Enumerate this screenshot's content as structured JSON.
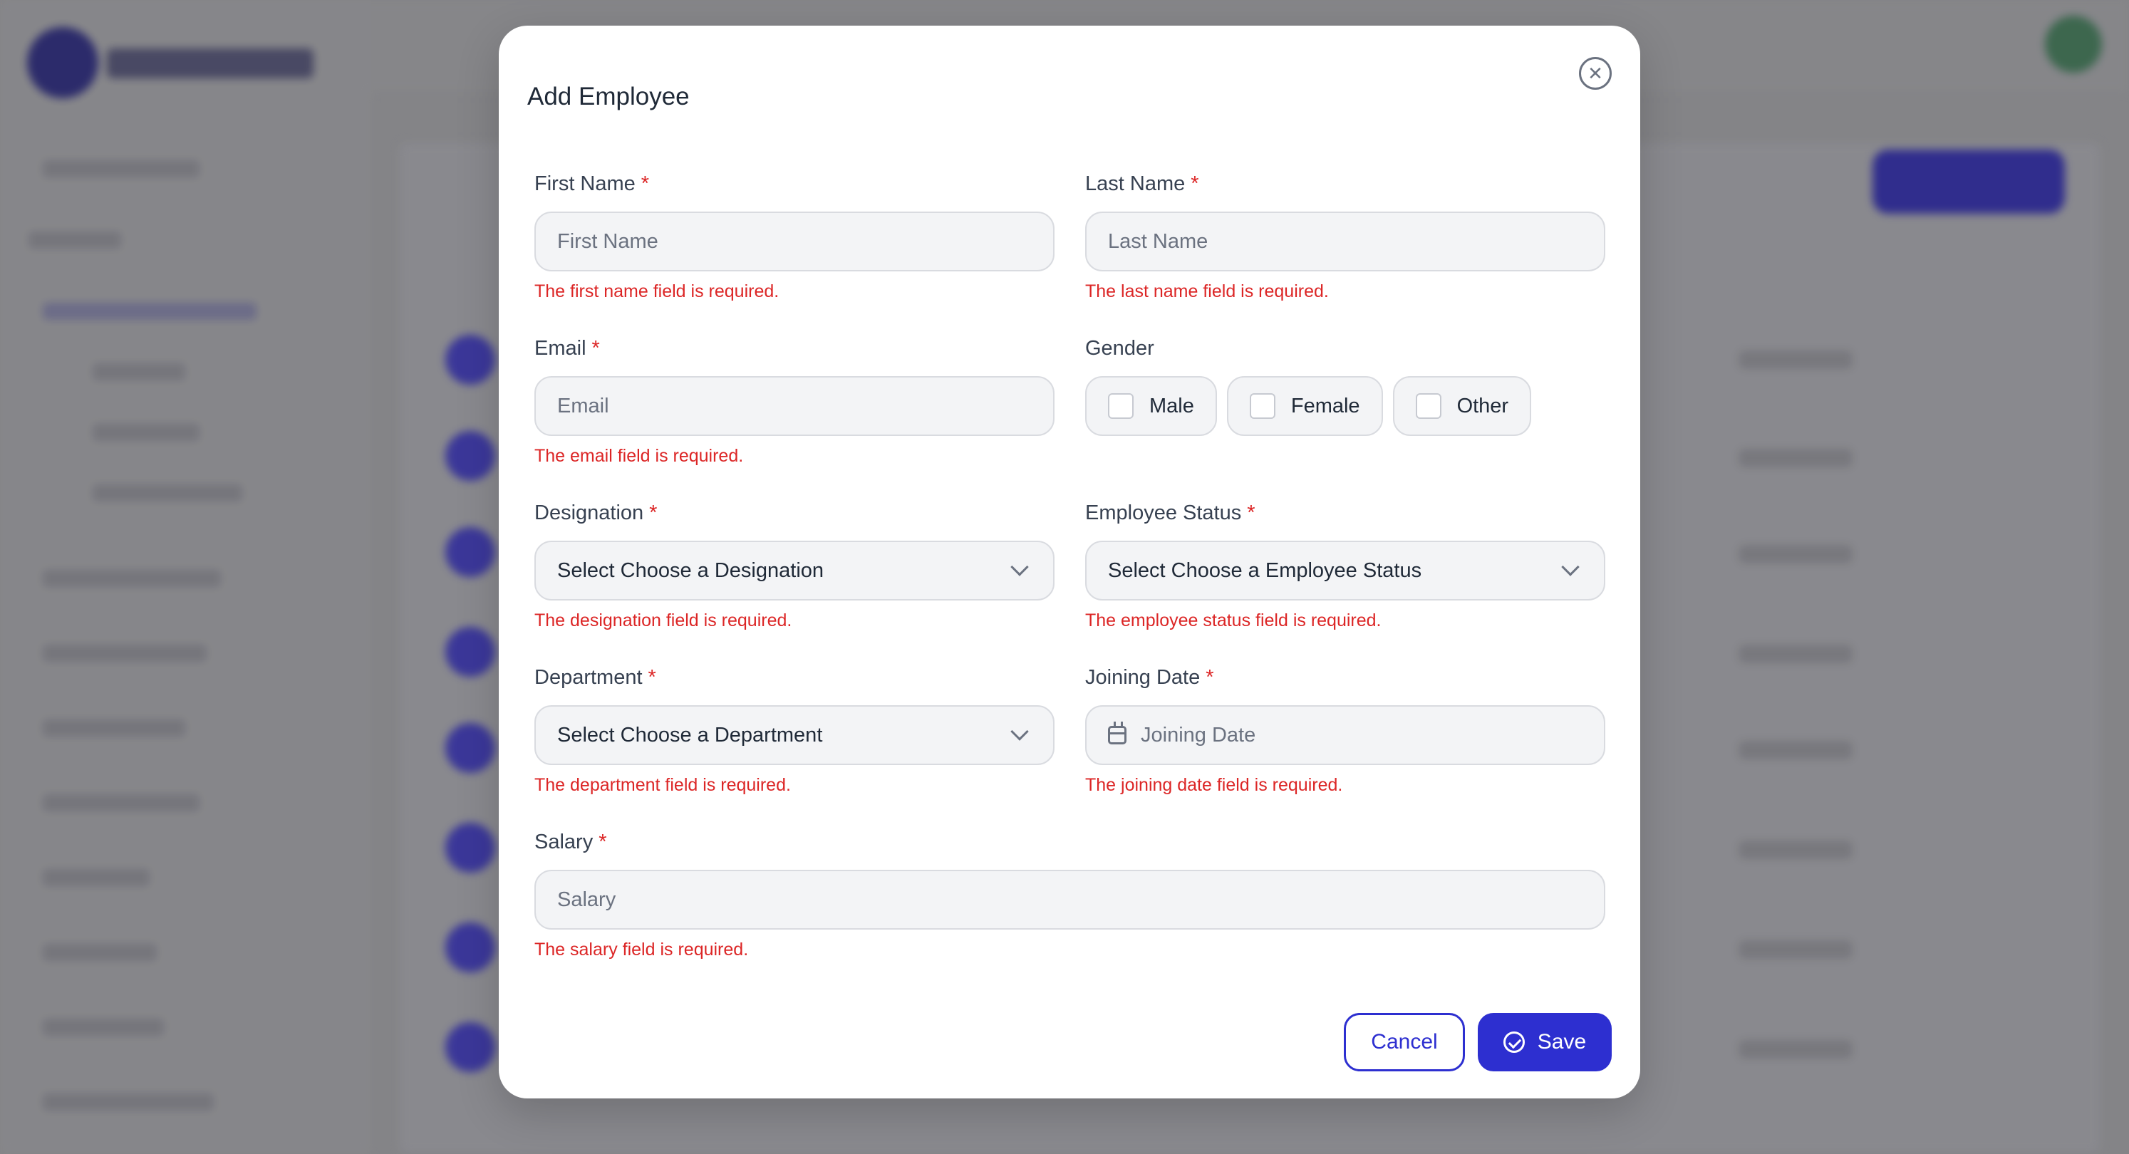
{
  "modal": {
    "title": "Add Employee",
    "close_icon": "close-circle-icon",
    "save_icon": "check-circle-icon",
    "calendar_icon": "calendar-icon",
    "required_mark": "*",
    "fields": {
      "first_name": {
        "label": "First Name",
        "placeholder": "First Name",
        "error": "The first name field is required."
      },
      "last_name": {
        "label": "Last Name",
        "placeholder": "Last Name",
        "error": "The last name field is required."
      },
      "email": {
        "label": "Email",
        "placeholder": "Email",
        "error": "The email field is required."
      },
      "gender": {
        "label": "Gender",
        "options": [
          "Male",
          "Female",
          "Other"
        ]
      },
      "designation": {
        "label": "Designation",
        "value": "Select Choose a Designation",
        "error": "The designation field is required."
      },
      "employee_status": {
        "label": "Employee Status",
        "value": "Select Choose a Employee Status",
        "error": "The employee status field is required."
      },
      "department": {
        "label": "Department",
        "value": "Select Choose a Department",
        "error": "The department field is required."
      },
      "joining_date": {
        "label": "Joining Date",
        "placeholder": "Joining Date",
        "error": "The joining date field is required."
      },
      "salary": {
        "label": "Salary",
        "placeholder": "Salary",
        "error": "The salary field is required."
      }
    },
    "buttons": {
      "cancel": "Cancel",
      "save": "Save"
    }
  },
  "colors": {
    "accent": "#2d2fd0",
    "error": "#dc2626",
    "input_bg": "#f3f4f6",
    "overlay": "#8a8a8d"
  }
}
